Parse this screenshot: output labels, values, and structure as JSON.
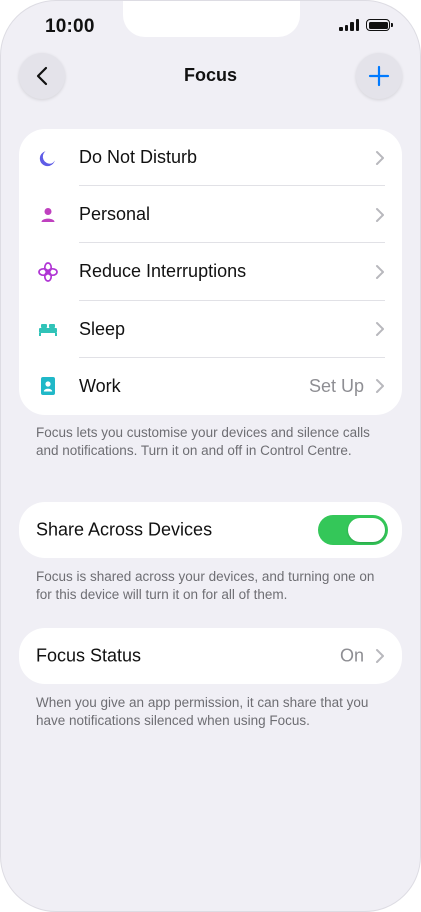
{
  "status_bar": {
    "time": "10:00"
  },
  "nav": {
    "title": "Focus",
    "back_icon": "chevron-left-icon",
    "add_icon": "plus-icon"
  },
  "focus_modes": [
    {
      "label": "Do Not Disturb",
      "icon": "moon-icon",
      "color": "#5e5ce6",
      "value": ""
    },
    {
      "label": "Personal",
      "icon": "person-icon",
      "color": "#bf40bf",
      "value": ""
    },
    {
      "label": "Reduce Interruptions",
      "icon": "flower-icon",
      "color": "#b034d4",
      "value": ""
    },
    {
      "label": "Sleep",
      "icon": "bed-icon",
      "color": "#30c3b8",
      "value": ""
    },
    {
      "label": "Work",
      "icon": "id-badge-icon",
      "color": "#20b8c8",
      "value": "Set Up"
    }
  ],
  "focus_footnote": "Focus lets you customise your devices and silence calls and notifications. Turn it on and off in Control Centre.",
  "share_across_devices": {
    "label": "Share Across Devices",
    "enabled": true,
    "toggle_color": "#34c759",
    "footnote": "Focus is shared across your devices, and turning one on for this device will turn it on for all of them."
  },
  "focus_status": {
    "label": "Focus Status",
    "value": "On",
    "footnote": "When you give an app permission, it can share that you have notifications silenced when using Focus."
  },
  "colors": {
    "accent": "#007aff",
    "background": "#f0eff5",
    "card": "#ffffff",
    "secondary_text": "#8e8e93"
  }
}
